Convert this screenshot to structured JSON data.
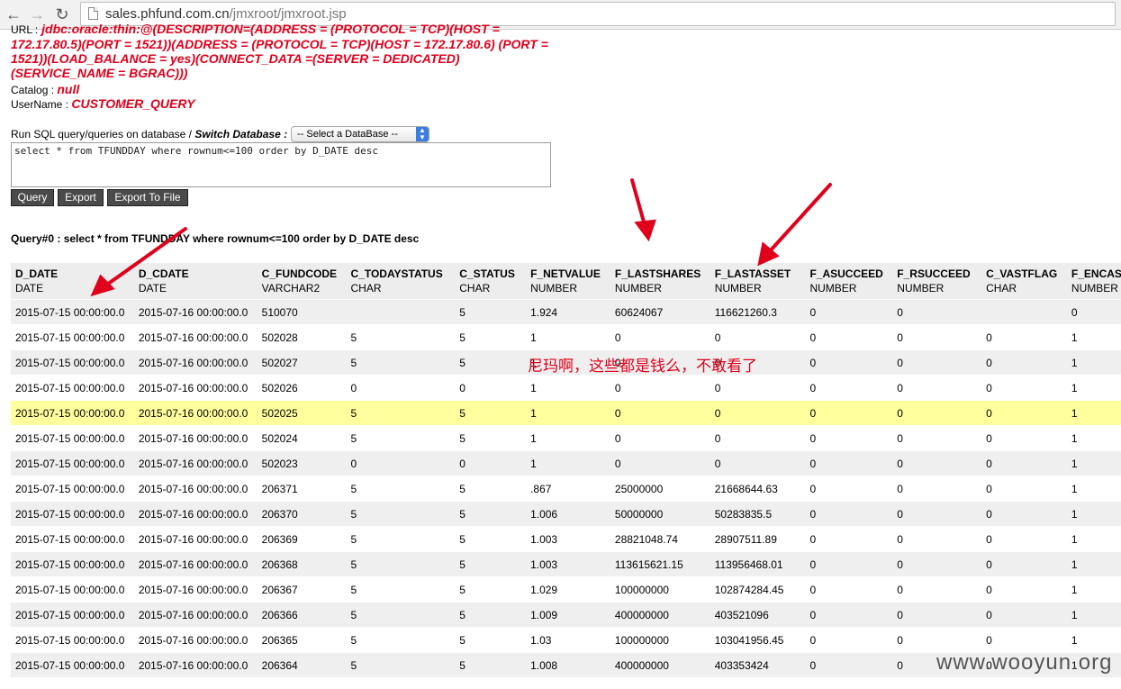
{
  "browser": {
    "url_host": "sales.phfund.com.cn",
    "url_path": "/jmxroot/jmxroot.jsp"
  },
  "connection": {
    "url_label": "URL :",
    "url_value": "jdbc:oracle:thin:@(DESCRIPTION=(ADDRESS = (PROTOCOL = TCP)(HOST = 172.17.80.5)(PORT = 1521))(ADDRESS = (PROTOCOL = TCP)(HOST = 172.17.80.6) (PORT = 1521))(LOAD_BALANCE = yes)(CONNECT_DATA =(SERVER = DEDICATED)(SERVICE_NAME = BGRAC)))",
    "catalog_label": "Catalog :",
    "catalog_value": "null",
    "username_label": "UserName :",
    "username_value": "CUSTOMER_QUERY"
  },
  "run": {
    "label": "Run SQL query/queries on database /",
    "switch_label": "Switch Database :",
    "select_value": "-- Select a DataBase --",
    "sql": "select * from TFUNDDAY where rownum<=100 order by D_DATE desc"
  },
  "buttons": {
    "query": "Query",
    "export": "Export",
    "export_file": "Export To File"
  },
  "query_title": "Query#0 : select * from TFUNDDAY where rownum<=100 order by D_DATE desc",
  "table": {
    "columns": [
      {
        "name": "D_DATE",
        "type": "DATE"
      },
      {
        "name": "D_CDATE",
        "type": "DATE"
      },
      {
        "name": "C_FUNDCODE",
        "type": "VARCHAR2"
      },
      {
        "name": "C_TODAYSTATUS",
        "type": "CHAR"
      },
      {
        "name": "C_STATUS",
        "type": "CHAR"
      },
      {
        "name": "F_NETVALUE",
        "type": "NUMBER"
      },
      {
        "name": "F_LASTSHARES",
        "type": "NUMBER"
      },
      {
        "name": "F_LASTASSET",
        "type": "NUMBER"
      },
      {
        "name": "F_ASUCCEED",
        "type": "NUMBER"
      },
      {
        "name": "F_RSUCCEED",
        "type": "NUMBER"
      },
      {
        "name": "C_VASTFLAG",
        "type": "CHAR"
      },
      {
        "name": "F_ENCASHRATIO",
        "type": "NUMBER"
      }
    ],
    "rows": [
      [
        "2015-07-15 00:00:00.0",
        "2015-07-16 00:00:00.0",
        "510070",
        "",
        "5",
        "1.924",
        "60624067",
        "116621260.3",
        "0",
        "0",
        "",
        "0"
      ],
      [
        "2015-07-15 00:00:00.0",
        "2015-07-16 00:00:00.0",
        "502028",
        "5",
        "5",
        "1",
        "0",
        "0",
        "0",
        "0",
        "0",
        "1"
      ],
      [
        "2015-07-15 00:00:00.0",
        "2015-07-16 00:00:00.0",
        "502027",
        "5",
        "5",
        "1",
        "0",
        "0",
        "0",
        "0",
        "0",
        "1"
      ],
      [
        "2015-07-15 00:00:00.0",
        "2015-07-16 00:00:00.0",
        "502026",
        "0",
        "0",
        "1",
        "0",
        "0",
        "0",
        "0",
        "0",
        "1"
      ],
      [
        "2015-07-15 00:00:00.0",
        "2015-07-16 00:00:00.0",
        "502025",
        "5",
        "5",
        "1",
        "0",
        "0",
        "0",
        "0",
        "0",
        "1"
      ],
      [
        "2015-07-15 00:00:00.0",
        "2015-07-16 00:00:00.0",
        "502024",
        "5",
        "5",
        "1",
        "0",
        "0",
        "0",
        "0",
        "0",
        "1"
      ],
      [
        "2015-07-15 00:00:00.0",
        "2015-07-16 00:00:00.0",
        "502023",
        "0",
        "0",
        "1",
        "0",
        "0",
        "0",
        "0",
        "0",
        "1"
      ],
      [
        "2015-07-15 00:00:00.0",
        "2015-07-16 00:00:00.0",
        "206371",
        "5",
        "5",
        ".867",
        "25000000",
        "21668644.63",
        "0",
        "0",
        "0",
        "1"
      ],
      [
        "2015-07-15 00:00:00.0",
        "2015-07-16 00:00:00.0",
        "206370",
        "5",
        "5",
        "1.006",
        "50000000",
        "50283835.5",
        "0",
        "0",
        "0",
        "1"
      ],
      [
        "2015-07-15 00:00:00.0",
        "2015-07-16 00:00:00.0",
        "206369",
        "5",
        "5",
        "1.003",
        "28821048.74",
        "28907511.89",
        "0",
        "0",
        "0",
        "1"
      ],
      [
        "2015-07-15 00:00:00.0",
        "2015-07-16 00:00:00.0",
        "206368",
        "5",
        "5",
        "1.003",
        "113615621.15",
        "113956468.01",
        "0",
        "0",
        "0",
        "1"
      ],
      [
        "2015-07-15 00:00:00.0",
        "2015-07-16 00:00:00.0",
        "206367",
        "5",
        "5",
        "1.029",
        "100000000",
        "102874284.45",
        "0",
        "0",
        "0",
        "1"
      ],
      [
        "2015-07-15 00:00:00.0",
        "2015-07-16 00:00:00.0",
        "206366",
        "5",
        "5",
        "1.009",
        "400000000",
        "403521096",
        "0",
        "0",
        "0",
        "1"
      ],
      [
        "2015-07-15 00:00:00.0",
        "2015-07-16 00:00:00.0",
        "206365",
        "5",
        "5",
        "1.03",
        "100000000",
        "103041956.45",
        "0",
        "0",
        "0",
        "1"
      ],
      [
        "2015-07-15 00:00:00.0",
        "2015-07-16 00:00:00.0",
        "206364",
        "5",
        "5",
        "1.008",
        "400000000",
        "403353424",
        "0",
        "0",
        "0",
        "1"
      ]
    ],
    "highlight_row": 4
  },
  "annotation": "尼玛啊，这些都是钱么，不敢看了",
  "watermark": "www.wooyun.org",
  "colors": {
    "accent_red": "#e0001b",
    "header_bg": "#ededed",
    "row_odd": "#efefef",
    "row_highlight": "#ffff9e",
    "button_bg": "#4a4a4a"
  }
}
